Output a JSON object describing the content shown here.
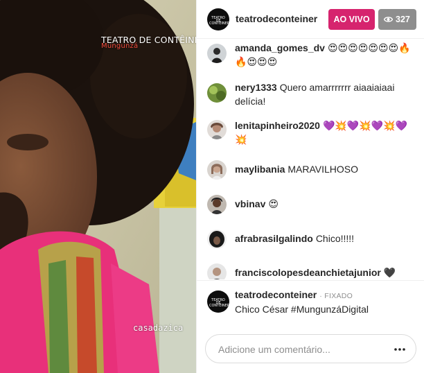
{
  "video": {
    "watermark_line1": "TEATRO DE CONTÊINER",
    "watermark_line2": "Mungunzá",
    "handle": "casadazica"
  },
  "header": {
    "username": "teatrodeconteiner",
    "live_label": "AO VIVO",
    "viewer_count": "327",
    "avatar_text": "TEATRO DE CONTÊINER"
  },
  "comments": [
    {
      "user": "amanda_gomes_dv",
      "text": "😍😍😍😍😍😍😍🔥🔥😍😍😍"
    },
    {
      "user": "nery1333",
      "text": "Quero amarrrrrrr aiaaiaiaai delícia!"
    },
    {
      "user": "lenitapinheiro2020",
      "text": "💜💥💜💥💜💥💜💥"
    },
    {
      "user": "maylibania",
      "text": "MARAVILHOSO"
    },
    {
      "user": "vbinav",
      "text": "😍"
    },
    {
      "user": "afrabrasilgalindo",
      "text": "Chico!!!!!"
    },
    {
      "user": "franciscolopesdeanchietajunior",
      "text": "🖤"
    }
  ],
  "pinned": {
    "user": "teatrodeconteiner",
    "badge": "· FIXADO",
    "text": "Chico César #MungunzáDigital"
  },
  "composer": {
    "placeholder": "Adicione um comentário...",
    "more_icon": "ellipsis-icon"
  },
  "colors": {
    "live_badge": "#d6246e",
    "viewer_badge": "#8e8e8e",
    "text": "#262626",
    "muted": "#8e8e8e"
  }
}
